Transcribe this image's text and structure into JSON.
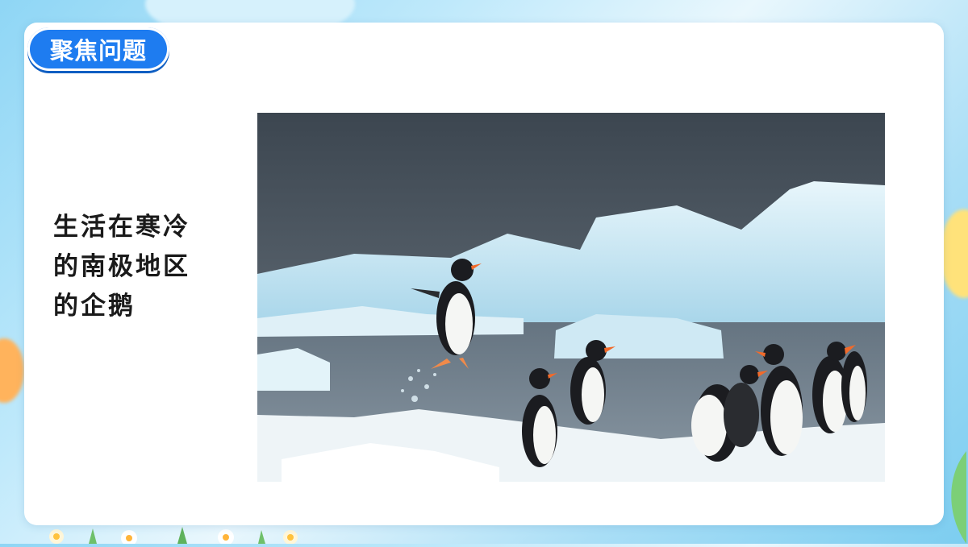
{
  "header": {
    "badge_label": "聚焦问题"
  },
  "main": {
    "text_lines": [
      "生活在寒冷",
      "的南极地区",
      "的企鹅"
    ]
  },
  "photo": {
    "subject": "penguins-on-antarctic-ice"
  },
  "colors": {
    "badge": "#1e7cf0",
    "card": "#ffffff",
    "background": "#a9def6"
  }
}
